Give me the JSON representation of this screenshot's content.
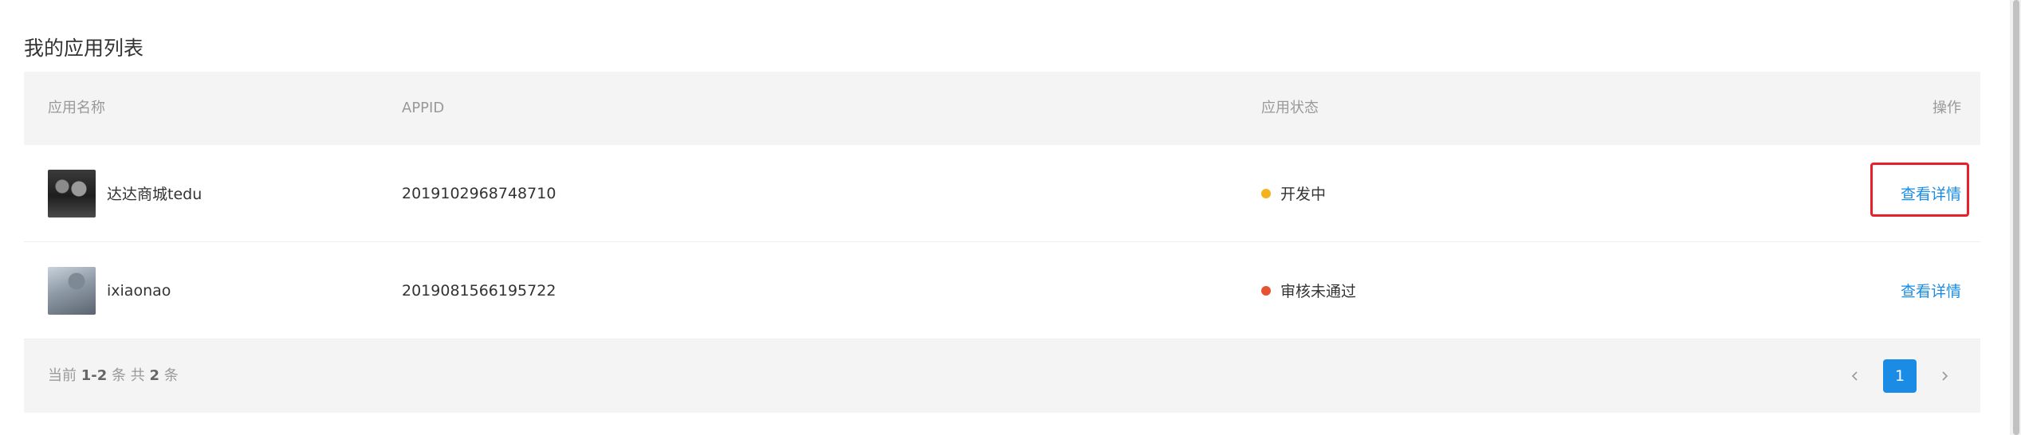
{
  "page": {
    "title": "我的应用列表"
  },
  "table": {
    "headers": {
      "name": "应用名称",
      "appid": "APPID",
      "status": "应用状态",
      "operation": "操作"
    },
    "rows": [
      {
        "name": "达达商城tedu",
        "appid": "2019102968748710",
        "status": "开发中",
        "status_color": "#f5b21c",
        "action": "查看详情"
      },
      {
        "name": "ixiaonao",
        "appid": "2019081566195722",
        "status": "审核未通过",
        "status_color": "#e8532f",
        "action": "查看详情"
      }
    ]
  },
  "pagination": {
    "prefix": "当前",
    "range": "1-2",
    "mid": "条 共",
    "total": "2",
    "suffix": "条",
    "current_page": "1",
    "prev_icon": "chevron-left-icon",
    "next_icon": "chevron-right-icon"
  },
  "colors": {
    "accent": "#1a8ce6",
    "highlight": "#e8202a",
    "header_bg": "#f4f4f4"
  }
}
